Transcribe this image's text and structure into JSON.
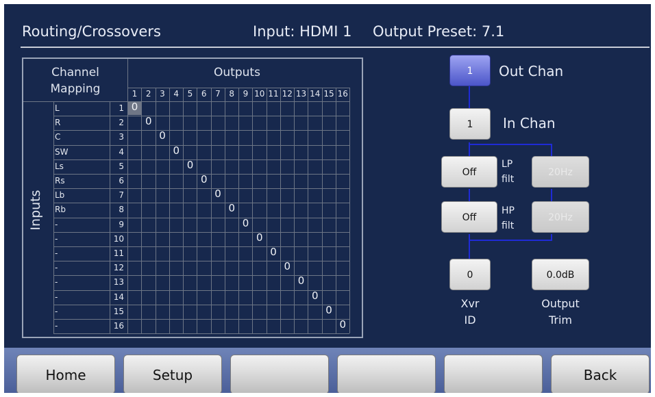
{
  "header": {
    "title": "Routing/Crossovers",
    "input": "Input: HDMI 1",
    "preset": "Output Preset: 7.1"
  },
  "matrix": {
    "channel_mapping_line1": "Channel",
    "channel_mapping_line2": "Mapping",
    "outputs_label": "Outputs",
    "inputs_label": "Inputs",
    "output_columns": [
      "1",
      "2",
      "3",
      "4",
      "5",
      "6",
      "7",
      "8",
      "9",
      "10",
      "11",
      "12",
      "13",
      "14",
      "15",
      "16"
    ],
    "input_rows": [
      {
        "name": "L",
        "num": "1",
        "value": "0"
      },
      {
        "name": "R",
        "num": "2",
        "value": "0"
      },
      {
        "name": "C",
        "num": "3",
        "value": "0"
      },
      {
        "name": "SW",
        "num": "4",
        "value": "0"
      },
      {
        "name": "Ls",
        "num": "5",
        "value": "0"
      },
      {
        "name": "Rs",
        "num": "6",
        "value": "0"
      },
      {
        "name": "Lb",
        "num": "7",
        "value": "0"
      },
      {
        "name": "Rb",
        "num": "8",
        "value": "0"
      },
      {
        "name": "-",
        "num": "9",
        "value": "0"
      },
      {
        "name": "-",
        "num": "10",
        "value": "0"
      },
      {
        "name": "-",
        "num": "11",
        "value": "0"
      },
      {
        "name": "-",
        "num": "12",
        "value": "0"
      },
      {
        "name": "-",
        "num": "13",
        "value": "0"
      },
      {
        "name": "-",
        "num": "14",
        "value": "0"
      },
      {
        "name": "-",
        "num": "15",
        "value": "0"
      },
      {
        "name": "-",
        "num": "16",
        "value": "0"
      }
    ]
  },
  "controls": {
    "out_chan_value": "1",
    "out_chan_label": "Out Chan",
    "in_chan_value": "1",
    "in_chan_label": "In Chan",
    "lp_value": "Off",
    "lp_label_1": "LP",
    "lp_label_2": "filt",
    "lp_freq": "20Hz",
    "hp_value": "Off",
    "hp_label_1": "HP",
    "hp_label_2": "filt",
    "hp_freq": "20Hz",
    "xvr_value": "0",
    "xvr_label_1": "Xvr",
    "xvr_label_2": "ID",
    "trim_value": "0.0dB",
    "trim_label_1": "Output",
    "trim_label_2": "Trim"
  },
  "bottom_bar": {
    "home": "Home",
    "setup": "Setup",
    "blank3": "",
    "blank4": "",
    "blank5": "",
    "back": "Back"
  },
  "colors": {
    "background": "#17284d",
    "selected_button": "#5a63d8",
    "connector": "#1f2bd6"
  }
}
